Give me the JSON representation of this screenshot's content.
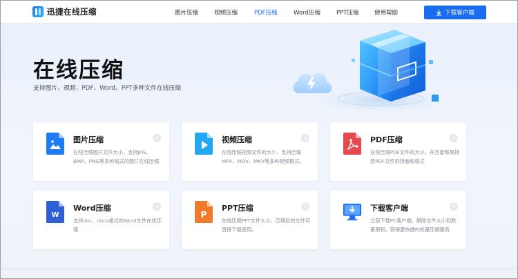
{
  "header": {
    "logo_text": "迅捷在线压缩",
    "nav": [
      {
        "label": "图片压缩",
        "active": false
      },
      {
        "label": "视频压缩",
        "active": false
      },
      {
        "label": "PDF压缩",
        "active": true
      },
      {
        "label": "Word压缩",
        "active": false
      },
      {
        "label": "PPT压缩",
        "active": false
      },
      {
        "label": "使用帮助",
        "active": false
      }
    ],
    "download_label": "下载客户端"
  },
  "hero": {
    "title": "在线压缩",
    "subtitle": "支持图片、视频、PDF、Word、PPT多种文件在线压缩"
  },
  "cards": [
    {
      "title": "图片压缩",
      "desc": "在线压缩图片文件大小，支持JPG、BMP、PNG等多种格式的图片在线压缩",
      "icon": "image-file-icon",
      "color": "#1e7af5"
    },
    {
      "title": "视频压缩",
      "desc": "在线压缩视频文件的大小，支持压缩MP4、MOV、MKV等多种视频格式。",
      "icon": "video-file-icon",
      "color": "#22a7f0"
    },
    {
      "title": "PDF压缩",
      "desc": "在线压缩PDF文件的大小，并且能够保持原PDF文件的排版和格式",
      "icon": "pdf-file-icon",
      "color": "#e5484d"
    },
    {
      "title": "Word压缩",
      "desc": "支持doc、docx格式的Word文件在线压缩",
      "icon": "word-file-icon",
      "color": "#2f5fd6"
    },
    {
      "title": "PPT压缩",
      "desc": "在线压缩PPT文件大小，压缩后的文件可直接下载使用。",
      "icon": "ppt-file-icon",
      "color": "#f07a2b"
    },
    {
      "title": "下载客户端",
      "desc": "立刻下载PC客户端，解除文件大小和数量限制，获得更快捷的批量压缩服务",
      "icon": "desktop-download-icon",
      "color": "#1a6cf0"
    }
  ],
  "colors": {
    "accent": "#1a6cf0",
    "background": "#eef3fb"
  }
}
